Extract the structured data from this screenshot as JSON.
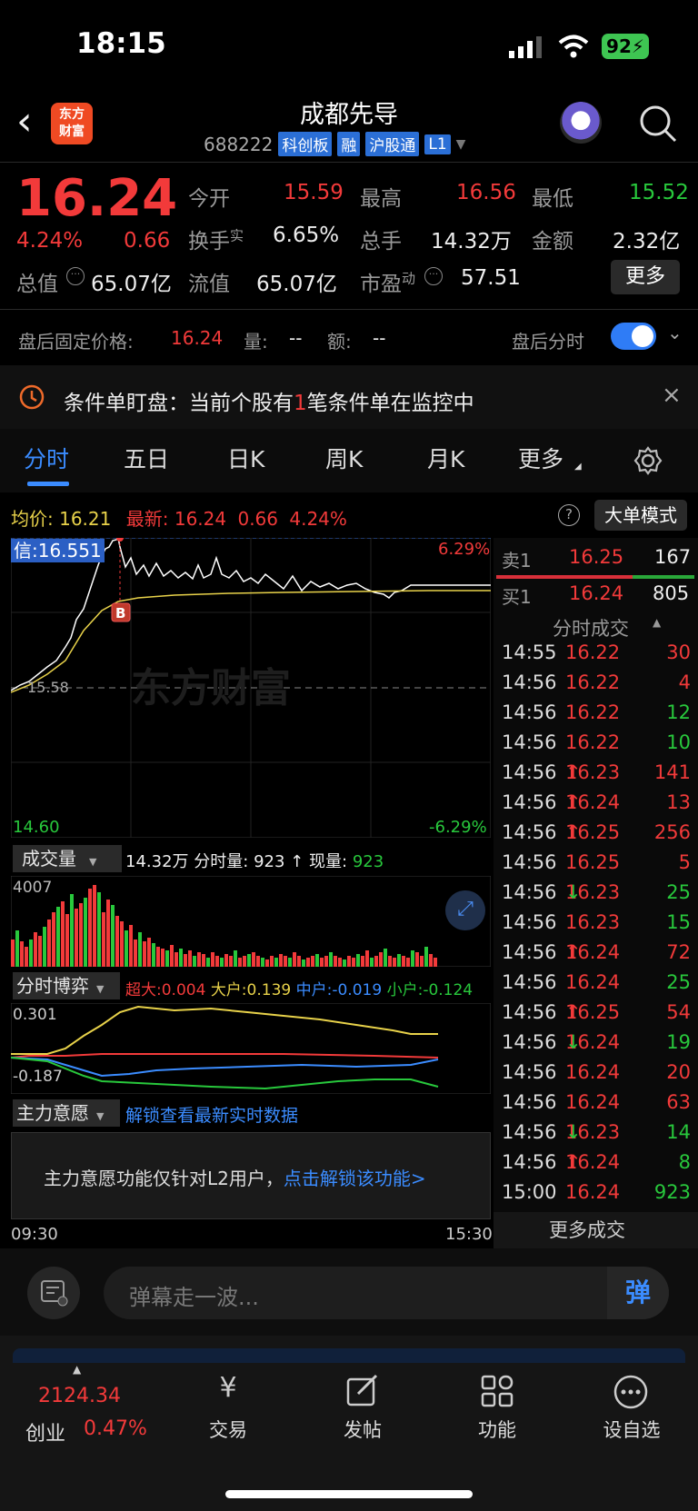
{
  "status": {
    "time": "18:15",
    "battery": "92"
  },
  "header": {
    "title": "成都先导",
    "code": "688222",
    "tags": [
      "科创板",
      "融",
      "沪股通",
      "L1"
    ],
    "logo_line1": "东方",
    "logo_line2": "财富"
  },
  "quote": {
    "price": "16.24",
    "pct": "4.24%",
    "chg": "0.66",
    "open_label": "今开",
    "open": "15.59",
    "high_label": "最高",
    "high": "16.56",
    "low_label": "最低",
    "low": "15.52",
    "turnover_label": "换手",
    "turnover_sup": "实",
    "turnover": "6.65%",
    "vol_label": "总手",
    "vol": "14.32万",
    "amt_label": "金额",
    "amt": "2.32亿",
    "mcap_label": "总值",
    "mcap": "65.07亿",
    "float_label": "流值",
    "float": "65.07亿",
    "pe_label": "市盈",
    "pe_sup": "动",
    "pe": "57.51",
    "more": "更多"
  },
  "after": {
    "label": "盘后固定价格:",
    "price": "16.24",
    "vol_label": "量:",
    "vol": "--",
    "amt_label": "额:",
    "amt": "--",
    "toggle_label": "盘后分时"
  },
  "notice": {
    "pre": "条件单盯盘：当前个股有",
    "num": "1",
    "post": "笔条件单在监控中"
  },
  "tabs": [
    "分时",
    "五日",
    "日K",
    "周K",
    "月K",
    "更多"
  ],
  "chart_info": {
    "avg_label": "均价:",
    "avg": "16.21",
    "last_label": "最新:",
    "last": "16.24",
    "chg": "0.66",
    "pct": "4.24%",
    "mode": "大单模式",
    "hl": "信:16.551",
    "top_pct": "6.29%",
    "bot_price": "14.60",
    "bot_pct": "-6.29%",
    "mid": "15.58",
    "b": "B",
    "watermark": "东方财富"
  },
  "vol_bar": {
    "label": "成交量",
    "total": "14.32万",
    "fs_label": "分时量:",
    "fs": "923",
    "cur_label": "现量:",
    "cur": "923",
    "max": "4007"
  },
  "game": {
    "label": "分时博弈",
    "cd_label": "超大:",
    "cd": "0.004",
    "dh_label": "大户:",
    "dh": "0.139",
    "zh_label": "中户:",
    "zh": "-0.019",
    "xh_label": "小户:",
    "xh": "-0.124",
    "top": "0.301",
    "bot": "-0.187"
  },
  "zl": {
    "label": "主力意愿",
    "link": "解锁查看最新实时数据",
    "msg": "主力意愿功能仅针对L2用户，",
    "unlock": "点击解锁该功能>"
  },
  "time_axis": {
    "start": "09:30",
    "end": "15:30"
  },
  "orderbook": {
    "sell_label": "卖1",
    "sell_price": "16.25",
    "sell_vol": "167",
    "buy_label": "买1",
    "buy_price": "16.24",
    "buy_vol": "805"
  },
  "trades_title": "分时成交",
  "trades": [
    {
      "t": "14:55",
      "p": "16.22",
      "a": "",
      "v": "30",
      "c": "red"
    },
    {
      "t": "14:56",
      "p": "16.22",
      "a": "",
      "v": "4",
      "c": "red"
    },
    {
      "t": "14:56",
      "p": "16.22",
      "a": "",
      "v": "12",
      "c": "green"
    },
    {
      "t": "14:56",
      "p": "16.22",
      "a": "",
      "v": "10",
      "c": "green"
    },
    {
      "t": "14:56",
      "p": "16.23",
      "a": "↑",
      "v": "141",
      "c": "red"
    },
    {
      "t": "14:56",
      "p": "16.24",
      "a": "↑",
      "v": "13",
      "c": "red"
    },
    {
      "t": "14:56",
      "p": "16.25",
      "a": "↑",
      "v": "256",
      "c": "red"
    },
    {
      "t": "14:56",
      "p": "16.25",
      "a": "",
      "v": "5",
      "c": "red"
    },
    {
      "t": "14:56",
      "p": "16.23",
      "a": "↓",
      "v": "25",
      "c": "green"
    },
    {
      "t": "14:56",
      "p": "16.23",
      "a": "",
      "v": "15",
      "c": "green"
    },
    {
      "t": "14:56",
      "p": "16.24",
      "a": "↑",
      "v": "72",
      "c": "red"
    },
    {
      "t": "14:56",
      "p": "16.24",
      "a": "",
      "v": "25",
      "c": "green"
    },
    {
      "t": "14:56",
      "p": "16.25",
      "a": "↑",
      "v": "54",
      "c": "red"
    },
    {
      "t": "14:56",
      "p": "16.24",
      "a": "↓",
      "v": "19",
      "c": "green"
    },
    {
      "t": "14:56",
      "p": "16.24",
      "a": "",
      "v": "20",
      "c": "red"
    },
    {
      "t": "14:56",
      "p": "16.24",
      "a": "",
      "v": "63",
      "c": "red"
    },
    {
      "t": "14:56",
      "p": "16.23",
      "a": "↓",
      "v": "14",
      "c": "green"
    },
    {
      "t": "14:56",
      "p": "16.24",
      "a": "↑",
      "v": "8",
      "c": "green"
    },
    {
      "t": "15:00",
      "p": "16.24",
      "a": "",
      "v": "923",
      "c": "green"
    }
  ],
  "more_trades": "更多成交",
  "comment": {
    "placeholder": "弹幕走一波...",
    "btn": "弹"
  },
  "nav": {
    "index_val": "2124.34",
    "index_name": "创业",
    "index_pct": "0.47%",
    "items": [
      "交易",
      "发帖",
      "功能",
      "设自选"
    ]
  }
}
